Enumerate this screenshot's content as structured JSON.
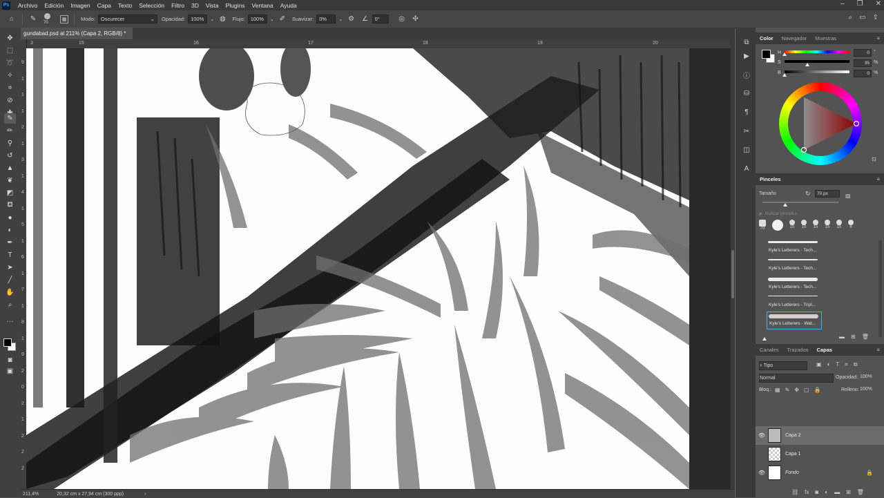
{
  "menu": {
    "logo": "Ps",
    "items": [
      "Archivo",
      "Edición",
      "Imagen",
      "Capa",
      "Texto",
      "Selección",
      "Filtro",
      "3D",
      "Vista",
      "Plugins",
      "Ventana",
      "Ayuda"
    ]
  },
  "options": {
    "brush_size": "70",
    "mode_label": "Modo:",
    "mode_value": "Oscurecer",
    "opacity_label": "Opacidad:",
    "opacity_value": "100%",
    "flow_label": "Flujo:",
    "flow_value": "100%",
    "smoothing_label": "Suavizar:",
    "smoothing_value": "0%",
    "angle_value": "0°"
  },
  "document": {
    "tab_title": "gundabad.psd al 211% (Capa 2, RGB/8) *",
    "ruler_top": [
      "3",
      "15",
      "16",
      "17",
      "18",
      "19",
      "20"
    ],
    "ruler_left": [
      "9",
      "1",
      "1",
      "1",
      "2",
      "1",
      "3",
      "1",
      "4",
      "1",
      "5",
      "1",
      "6",
      "1",
      "7",
      "1",
      "8",
      "1",
      "9",
      "2",
      "0",
      "2",
      "1",
      "2",
      "2",
      "2"
    ]
  },
  "status": {
    "zoom": "211,4%",
    "size": "20,32 cm x 27,94 cm (300 ppp)"
  },
  "color_panel": {
    "tabs": [
      "Color",
      "Navegador",
      "Muestras"
    ],
    "h_label": "H",
    "s_label": "S",
    "b_label": "B",
    "h_value": "0",
    "s_value": "35",
    "b_value": "0",
    "h_unit": "°",
    "s_unit": "%",
    "b_unit": "%",
    "s_level": 0.35,
    "foreground": "#000000",
    "background": "#ffffff"
  },
  "brushes_panel": {
    "title": "Pinceles",
    "size_label": "Tamaño",
    "size_value": "70 px",
    "search_placeholder": "Buscar pinceles",
    "recent_sizes": [
      "70",
      "",
      "10",
      "10",
      "15",
      "15",
      "15",
      "8"
    ],
    "items": [
      "Kyle's Letterers - Tech...",
      "Kyle's Letterers - Tech...",
      "Kyle's Letterers - Tech...",
      "Kyle's Letterers - Tripl...",
      "Kyle's Letterers - Wat..."
    ]
  },
  "layers_panel": {
    "tabs": [
      "Canales",
      "Trazados",
      "Capas"
    ],
    "filter_label": "Tipo",
    "blend_mode": "Normal",
    "opacity_label": "Opacidad:",
    "opacity_value": "100%",
    "lock_label": "Bloq.:",
    "fill_label": "Relleno:",
    "fill_value": "100%",
    "layers": [
      {
        "name": "Capa 2",
        "visible": true,
        "selected": true
      },
      {
        "name": "Capa 1",
        "visible": false,
        "selected": false
      },
      {
        "name": "Fondo",
        "visible": true,
        "selected": false,
        "locked": true
      }
    ]
  }
}
